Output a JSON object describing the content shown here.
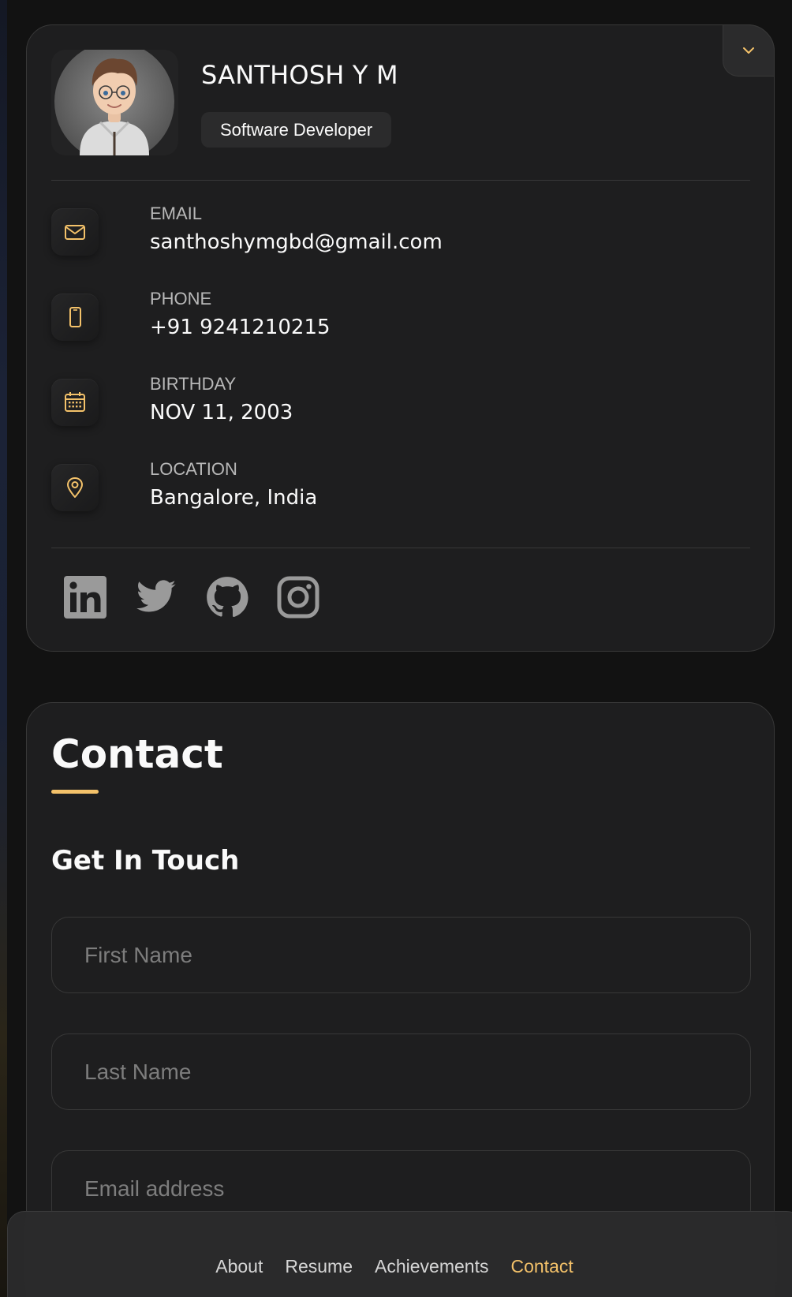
{
  "profile": {
    "name": "SANTHOSH Y M",
    "title": "Software Developer"
  },
  "contacts": [
    {
      "label": "Email",
      "value": "santhoshymgbd@gmail.com",
      "icon": "mail-icon"
    },
    {
      "label": "Phone",
      "value": "+91 9241210215",
      "icon": "phone-icon"
    },
    {
      "label": "Birthday",
      "value": "NOV 11, 2003",
      "icon": "calendar-icon"
    },
    {
      "label": "Location",
      "value": "Bangalore, India",
      "icon": "location-icon"
    }
  ],
  "social": [
    {
      "icon": "linkedin-icon"
    },
    {
      "icon": "twitter-icon"
    },
    {
      "icon": "github-icon"
    },
    {
      "icon": "instagram-icon"
    }
  ],
  "contact_section": {
    "title": "Contact",
    "form_title": "Get In Touch",
    "first_name_placeholder": "First Name",
    "last_name_placeholder": "Last Name",
    "email_placeholder": "Email address"
  },
  "navbar": {
    "items": [
      {
        "label": "About",
        "active": false
      },
      {
        "label": "Resume",
        "active": false
      },
      {
        "label": "Achievements",
        "active": false
      },
      {
        "label": "Contact",
        "active": true
      }
    ]
  },
  "colors": {
    "accent": "#f4c26a",
    "card_bg": "#1e1e1f",
    "page_bg": "#121212"
  }
}
